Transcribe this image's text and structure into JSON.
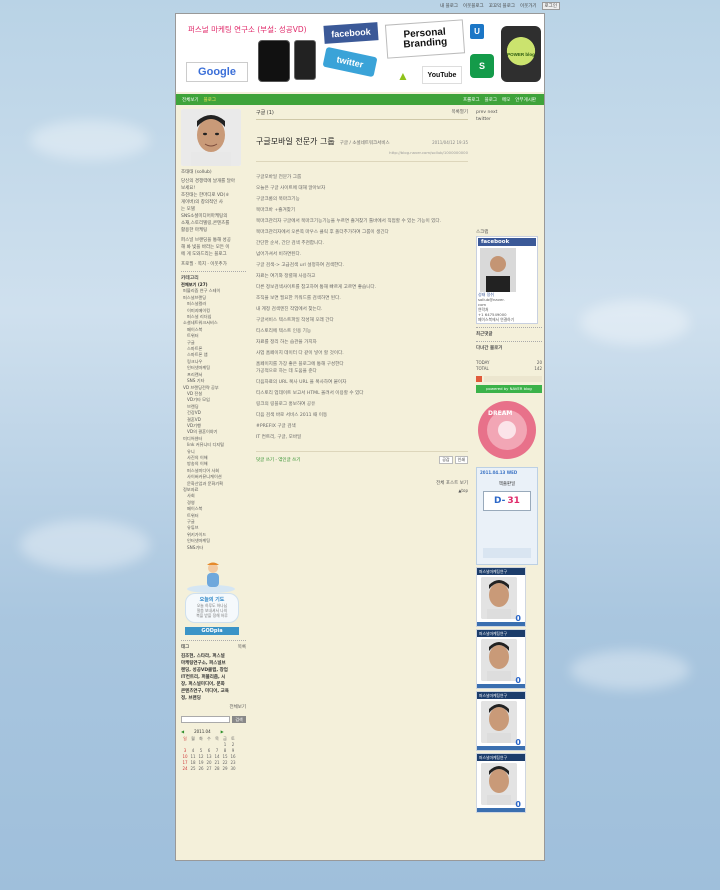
{
  "topbar": {
    "items": [
      "내 블로그",
      "이웃블로그",
      "꼬꼬익 블로그",
      "이웃가기",
      "로그인"
    ]
  },
  "banner": {
    "title": "퍼스널 마케팅 연구소 (부설: 성공VD)",
    "logos": {
      "facebook": "facebook",
      "personal_branding": "Personal Branding",
      "twitter": "twitter",
      "google": "Google",
      "youtube": "YouTube",
      "power_blog": "POWER blog",
      "uplus": "U"
    }
  },
  "nav": {
    "left": [
      "전체보기",
      "블로그"
    ],
    "right": [
      "프롤로그",
      "블로그",
      "메모",
      "안부게시판"
    ]
  },
  "profile": {
    "name": "조태태 (sollub)",
    "bio": [
      "당신의 경쟁력에 날개를 달아",
      "보세요!",
      "조진태는 한마디로 VD(ㅎ",
      "게이버)의 창의적인 사",
      "는 모델",
      "",
      "SNS소셜미디어마케팅의",
      "소재,스토리텔링,콘텐츠를",
      "활용한 마케팅"
    ],
    "bio2": [
      "퍼스널 브랜딩을 통해 성공",
      "해 봐 빛을 바라는 모든 이",
      "에 게 도와드리는 블로그"
    ],
    "link": "프로필 · 쪽지 · 이웃추가"
  },
  "categories": {
    "title": "카테고리",
    "items": [
      {
        "label": "전체보기 (27)",
        "level": 0
      },
      {
        "label": "퍼블리즘 연구 스테이",
        "level": 1
      },
      {
        "label": "퍼스널브랜딩",
        "level": 1
      },
      {
        "label": "퍼스널컬러",
        "level": 2
      },
      {
        "label": "이미지메이킹",
        "level": 2
      },
      {
        "label": "퍼스널 리더십",
        "level": 2
      },
      {
        "label": "소셜네트워크서비스",
        "level": 1
      },
      {
        "label": "페이스북",
        "level": 2
      },
      {
        "label": "트위터",
        "level": 2
      },
      {
        "label": "구글",
        "level": 2
      },
      {
        "label": "스마트폰",
        "level": 2
      },
      {
        "label": "스마트폰 앱",
        "level": 2
      },
      {
        "label": "링크나우",
        "level": 2
      },
      {
        "label": "인터넷마케팅",
        "level": 2
      },
      {
        "label": "프리랜서",
        "level": 2
      },
      {
        "label": "SNS 기타",
        "level": 2
      },
      {
        "label": "VD 브랜딩전략 공부",
        "level": 1
      },
      {
        "label": "VD 전설",
        "level": 2
      },
      {
        "label": "VD기타 모임",
        "level": 2
      },
      {
        "label": "브랜딩",
        "level": 2
      },
      {
        "label": "건강VD",
        "level": 2
      },
      {
        "label": "결혼VD",
        "level": 2
      },
      {
        "label": "VD기행",
        "level": 2
      },
      {
        "label": "VD의 결혼이야기",
        "level": 2
      },
      {
        "label": "미디어센터",
        "level": 1
      },
      {
        "label": "link 커뮤니티 디지털",
        "level": 2
      },
      {
        "label": "유니",
        "level": 2
      },
      {
        "label": "사진의 이해",
        "level": 2
      },
      {
        "label": "방송의 이해",
        "level": 2
      },
      {
        "label": "퍼스널미디어 사회",
        "level": 2
      },
      {
        "label": "사이버커뮤니케이션",
        "level": 2
      },
      {
        "label": "문화산업과 문화기획",
        "level": 2
      },
      {
        "label": "정보자료",
        "level": 1
      },
      {
        "label": "사회",
        "level": 2
      },
      {
        "label": "경영",
        "level": 2
      },
      {
        "label": "페이스북",
        "level": 2
      },
      {
        "label": "트위터",
        "level": 2
      },
      {
        "label": "구글",
        "level": 2
      },
      {
        "label": "유튜브",
        "level": 2
      },
      {
        "label": "위키가이드",
        "level": 2
      },
      {
        "label": "인터넷마케팅",
        "level": 2
      },
      {
        "label": "SNS기타",
        "level": 2
      }
    ]
  },
  "prayer": {
    "title": "오늘의 기도",
    "body": [
      "오늘 하루도 하나님",
      "말씀 보내셔서 나의",
      "복을 받을 정해 하루"
    ],
    "btn": "GODpia"
  },
  "tags": {
    "title": "태그",
    "more": "목록",
    "text": [
      "김조현, 스타라, 퍼스널",
      "마케팅연구소, 퍼스널브",
      "랜딩, 성공VD클럽, 창업",
      "IT컨트리, 퍼블리즘, 시",
      "장, 퍼스널미디어, 문화",
      "콘텐츠연구, 미디어, 교육",
      "정, 브랜딩",
      "전체보기"
    ]
  },
  "calendar": {
    "month": "2011.04",
    "days": [
      "일",
      "월",
      "화",
      "수",
      "목",
      "금",
      "토"
    ],
    "dates": [
      "",
      "",
      "",
      "",
      "",
      "1",
      "2",
      "3",
      "4",
      "5",
      "6",
      "7",
      "8",
      "9",
      "10",
      "11",
      "12",
      "13",
      "14",
      "15",
      "16",
      "17",
      "18",
      "19",
      "20",
      "21",
      "22",
      "23",
      "24",
      "25",
      "26",
      "27",
      "28",
      "29",
      "30"
    ],
    "search_btn": "검색"
  },
  "post": {
    "category": "구글",
    "count": "(1)",
    "list_btn": "목록열기",
    "title": "구글모바일 전문가 그룹",
    "path": "구글 / 소셜네트워크서비스",
    "date": "2011/04/12 19:35",
    "url": "http://blog.naver.com/sollub/1000000000",
    "body": [
      "구글모바일 전문가 그룹",
      "",
      "오늘은 구글 사이트에 대해 알아보자",
      "",
      "구글크롬의 북마크기능",
      "",
      "북마크바 +즐겨찾기",
      "",
      "북마크관리자 구글에서 북마크기능기능을 누르면 즐겨찾기 툴바에서 직접할 수 있는 기능이 있다.",
      "",
      "북마크관리자에서 오른쪽 마우스 클릭 후 폴더추가하여 그룹이 생긴다",
      "",
      "간단한 순서, 간단 검색 추천합니다.",
      "",
      "넘어가셔서 비하면된다.",
      "",
      "구글 검색-> 고급검색 url 설정하여 검색한다.",
      "",
      "자료는 여기와 정렬해 사용하고",
      "",
      "다른 정보검색사이트를 참고하여 통해 빠르게 고르면 좋습니다.",
      "",
      "조직을 보면 필요한 키워드를 검색하면 된다.",
      "",
      "내 계정 검색엔진 작업에서 찾는다.",
      "",
      "구글서비스 텍스트파일 작성해 오래 간다",
      "",
      "티스토리에 텍스트 인용 기능",
      "",
      "자료를 정리 하는 습관을 가지자",
      "",
      "사업 홈페이지 데이터 다 같이 넣어 할 것이다.",
      "",
      "홈페이지를 가장 좋은 블로그에 통해 구성한다",
      "가공적으로 하는 데 도움을 준다",
      "",
      "다음자료의 URL 복사 URL 을 복사하여 붙이자",
      "",
      "티스토리 업데이트 보고서 HTML 올려서 이용할 수 있다",
      "",
      "링크의 링블로그 홍보하여 공유",
      "",
      "다음 검색 바로 서비스 2011 때 이동",
      "",
      "#PREFIX 구글 검색",
      "",
      "IT 컨트리, 구글, 모바일"
    ],
    "tags_label": "IT컨트리, 구글, 모바일",
    "comment_link": "덧글 쓰기",
    "trackback_link": "엮인글 쓰기",
    "scrap_label": "공감",
    "print_label": "인쇄",
    "more_link": "전체 포스트 보기",
    "top_link": "▲top"
  },
  "right": {
    "top": [
      "prev next",
      "twitter"
    ],
    "fb_label": "스크랩",
    "fb_title": "facebook",
    "fb_name": "성태 정쉬",
    "fb_meta": [
      "sollub@naver.",
      "com",
      "연락처",
      "+1 647549000",
      "페이스북에서 연결하기"
    ],
    "recent_comments": "최근댓글",
    "neighbors": "다녀간 블로거",
    "today_label": "TODAY",
    "today_val": "20",
    "total_label": "TOTAL",
    "total_val": "142",
    "powered": "powered by NAVER blog",
    "dream": "DREAM",
    "dday_label": "D-",
    "dday_val": "31",
    "dday_date": "2011.04.13 WED",
    "book_title": "책출판일",
    "sbox_label": "퍼스널마케팅연구",
    "sbox_val": "0",
    "sbox_count": 4
  }
}
